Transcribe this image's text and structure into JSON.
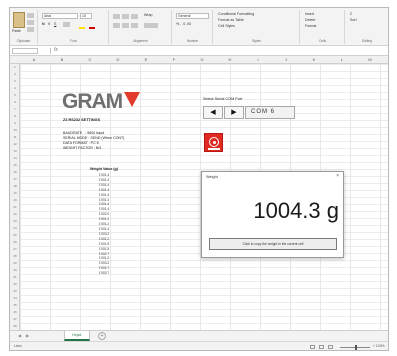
{
  "ribbon": {
    "paste_label": "Paste",
    "font_name": "Arial",
    "font_size": "10",
    "alignment_wrap": "Wrap",
    "number_format": "General",
    "number_format_symbols": "% , .0 .00",
    "styles_conditional": "Conditional Formatting",
    "styles_table": "Format as Table",
    "styles_cell": "Cell Styles",
    "cells_insert": "Insert",
    "cells_delete": "Delete",
    "cells_format": "Format",
    "editing_sum": "Σ",
    "editing_sort": "Sort",
    "group_clipboard": "Clipboard",
    "group_font": "Font",
    "group_alignment": "Alignment",
    "group_number": "Number",
    "group_styles": "Styles",
    "group_cells": "Cells",
    "group_editing": "Editing"
  },
  "formula_bar": {
    "fx": "fx"
  },
  "columns": [
    "A",
    "B",
    "C",
    "D",
    "E",
    "F",
    "G",
    "H",
    "I",
    "J",
    "K",
    "L",
    "M"
  ],
  "rows": [
    "1",
    "2",
    "3",
    "4",
    "5",
    "6",
    "7",
    "8",
    "9",
    "10",
    "11",
    "12",
    "13",
    "14",
    "15",
    "16",
    "17",
    "18",
    "19",
    "20",
    "21",
    "22",
    "23",
    "24",
    "25",
    "26",
    "27",
    "28",
    "29",
    "30",
    "31",
    "32",
    "33",
    "34",
    "35",
    "36",
    "37",
    "38"
  ],
  "sheet": {
    "logo_text": "GRAM",
    "settings_title": "Z3 RS232 SETTINGS",
    "settings_lines": "BAUDRATE   : 9600 baud\nSERIAL MODE : SEND (When CONT)\nDATA FORMAT : PC 6\nWEIGHT FACTOR : NO",
    "weight_header": "Weight Value (g)",
    "weights": [
      "1'001.4",
      "1'001.4",
      "1'001.4",
      "1'001.4",
      "1'001.4",
      "1'001.4",
      "1'001.4",
      "1'001.4",
      "1'002.0",
      "1'001.2",
      "1'001.2",
      "1'001.4",
      "1'003.2",
      "1'001.2",
      "1'001.9",
      "1'001.5",
      "1'002.7",
      "1'001.2",
      "1'003.2",
      "1'002.7",
      "1'003.7"
    ],
    "com_port_label": "Select Serial COM Port",
    "prev_glyph": "◀",
    "next_glyph": "▶",
    "com_port_value": "COM 6",
    "scale_icon": "scale-icon"
  },
  "dialog": {
    "title": "Weight",
    "close_glyph": "×",
    "value": "1004.3 g",
    "button_label": "Click to copy the weight in the current cell"
  },
  "tabs": {
    "left_arrow": "◀",
    "right_arrow": "▶",
    "sheet_name": "Hoja1",
    "add_glyph": "+"
  },
  "status": {
    "ready": "Listo",
    "zoom": "+ 100%"
  },
  "colors": {
    "brand_red": "#e23b2e",
    "excel_green": "#217346",
    "logo_grey": "#6f6f6f"
  }
}
